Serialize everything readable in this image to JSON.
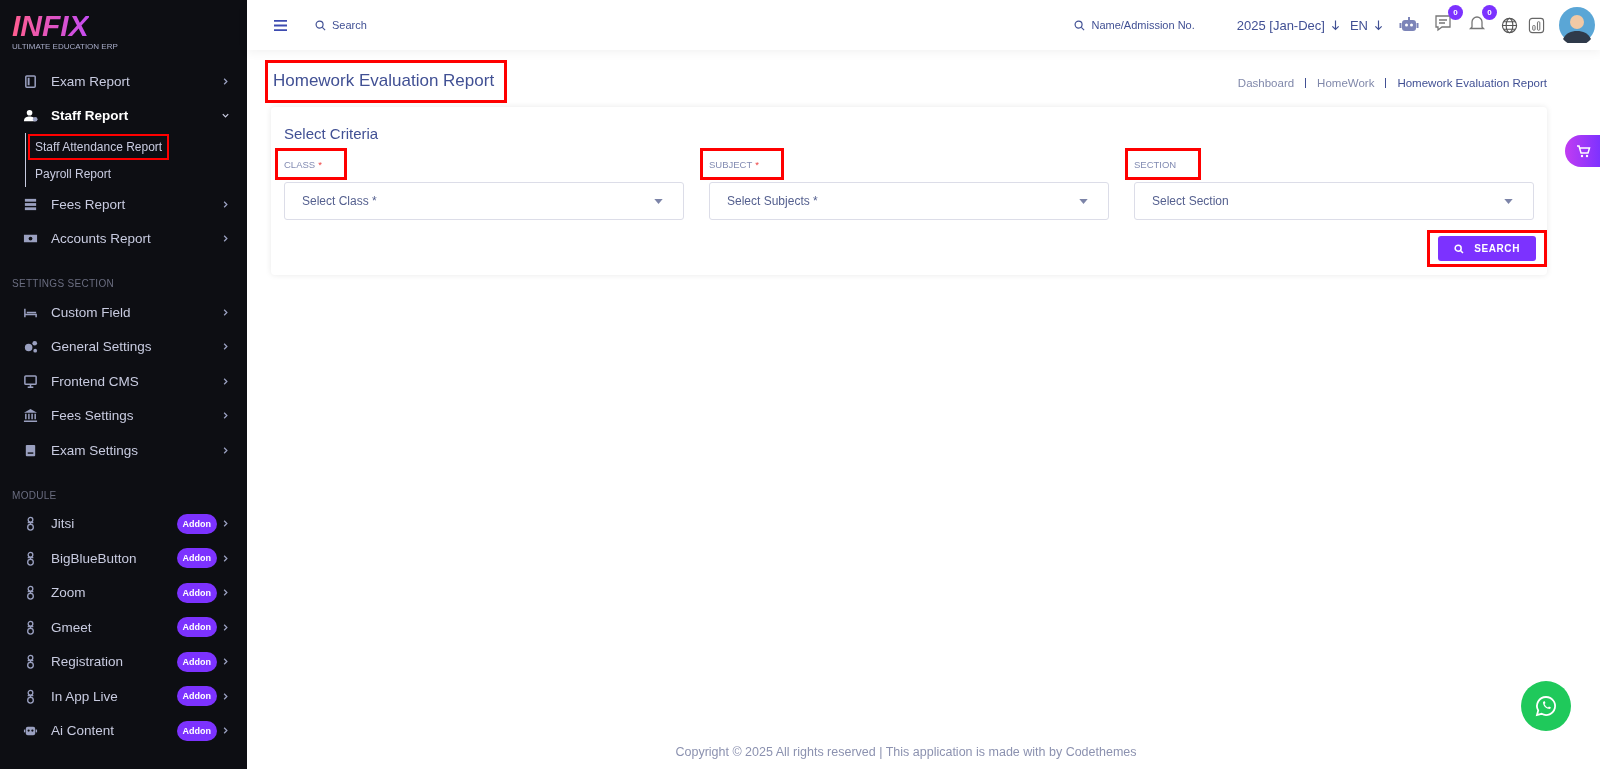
{
  "sidebar": {
    "logo": {
      "title": "INFIX",
      "tagline": "ULTIMATE EDUCATION ERP"
    },
    "groups": [
      {
        "items": [
          {
            "label": "Exam Report",
            "expanded": false
          },
          {
            "label": "Staff Report",
            "expanded": true,
            "children": [
              {
                "label": "Staff Attendance Report",
                "highlighted": true
              },
              {
                "label": "Payroll Report",
                "highlighted": false
              }
            ]
          },
          {
            "label": "Fees Report",
            "expanded": false
          },
          {
            "label": "Accounts Report",
            "expanded": false
          }
        ]
      },
      {
        "heading": "SETTINGS SECTION",
        "items": [
          {
            "label": "Custom Field",
            "expanded": false
          },
          {
            "label": "General Settings",
            "expanded": false
          },
          {
            "label": "Frontend CMS",
            "expanded": false
          },
          {
            "label": "Fees Settings",
            "expanded": false
          },
          {
            "label": "Exam Settings",
            "expanded": false
          }
        ]
      },
      {
        "heading": "MODULE",
        "items": [
          {
            "label": "Jitsi",
            "badge": "Addon",
            "expanded": false
          },
          {
            "label": "BigBlueButton",
            "badge": "Addon",
            "expanded": false
          },
          {
            "label": "Zoom",
            "badge": "Addon",
            "expanded": false
          },
          {
            "label": "Gmeet",
            "badge": "Addon",
            "expanded": false
          },
          {
            "label": "Registration",
            "badge": "Addon",
            "expanded": false
          },
          {
            "label": "In App Live",
            "badge": "Addon",
            "expanded": false
          },
          {
            "label": "Ai Content",
            "badge": "Addon",
            "expanded": false
          }
        ]
      }
    ]
  },
  "topbar": {
    "search_placeholder": "Search",
    "student_search_placeholder": "Name/Admission No.",
    "session": "2025 [Jan-Dec]",
    "language": "EN",
    "chat_count": "0",
    "notification_count": "0"
  },
  "page": {
    "title": "Homework Evaluation Report",
    "title_highlighted": true,
    "breadcrumbs": [
      {
        "label": "Dashboard",
        "selected": false
      },
      {
        "label": "HomeWork",
        "selected": false
      },
      {
        "label": "Homework Evaluation Report",
        "selected": true
      }
    ],
    "card": {
      "title": "Select Criteria",
      "fields": [
        {
          "label": "CLASS",
          "required_mark": "*",
          "placeholder": "Select Class *",
          "highlighted": true
        },
        {
          "label": "SUBJECT",
          "required_mark": "*",
          "placeholder": "Select Subjects *",
          "highlighted": true
        },
        {
          "label": "SECTION",
          "placeholder": "Select Section",
          "highlighted": true
        }
      ],
      "button": {
        "label": "SEARCH",
        "highlighted": true
      }
    }
  },
  "footer": "Copyright © 2025 All rights reserved | This application is made with by Codethemes"
}
